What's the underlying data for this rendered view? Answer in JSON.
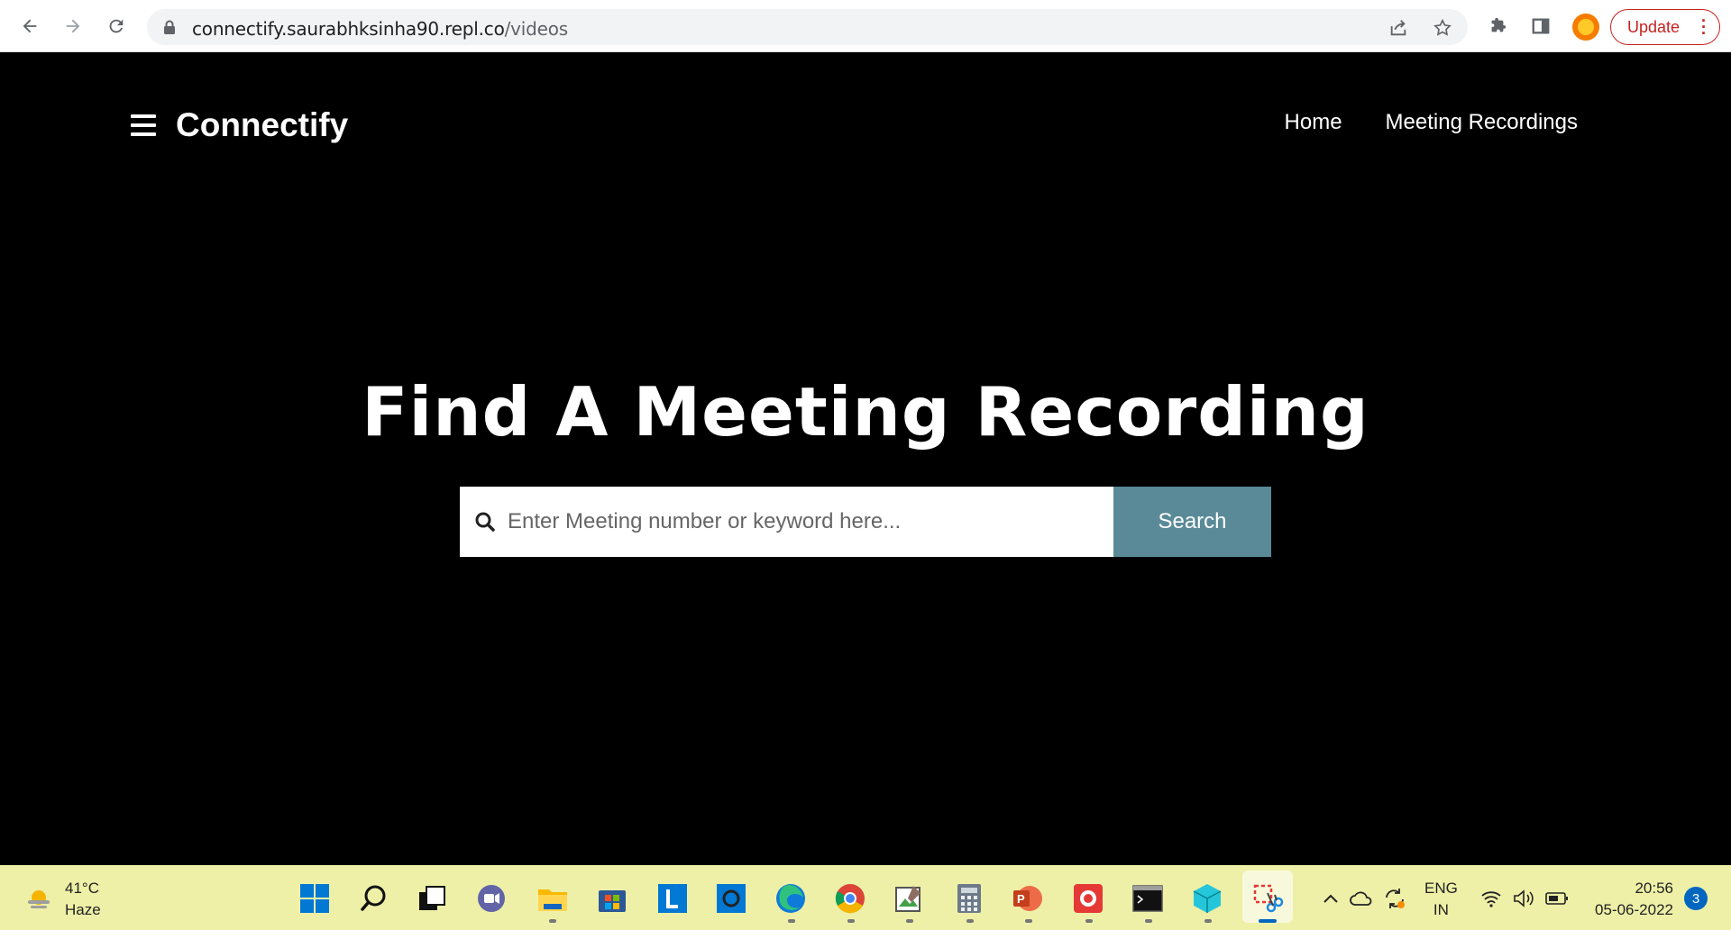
{
  "browser": {
    "url_host": "connectify.saurabhksinha90.repl.co",
    "url_path": "/videos",
    "update_label": "Update"
  },
  "site": {
    "brand": "Connectify",
    "nav": [
      {
        "label": "Home"
      },
      {
        "label": "Meeting Recordings"
      }
    ]
  },
  "hero": {
    "title": "Find A Meeting Recording",
    "search_placeholder": "Enter Meeting number or keyword here...",
    "search_button": "Search"
  },
  "taskbar": {
    "weather_temp": "41°C",
    "weather_desc": "Haze",
    "lang_top": "ENG",
    "lang_bottom": "IN",
    "time": "20:56",
    "date": "05-06-2022",
    "notification_count": "3"
  },
  "colors": {
    "accent_search_button": "#5a8a98",
    "taskbar_bg": "#eef0a7"
  }
}
